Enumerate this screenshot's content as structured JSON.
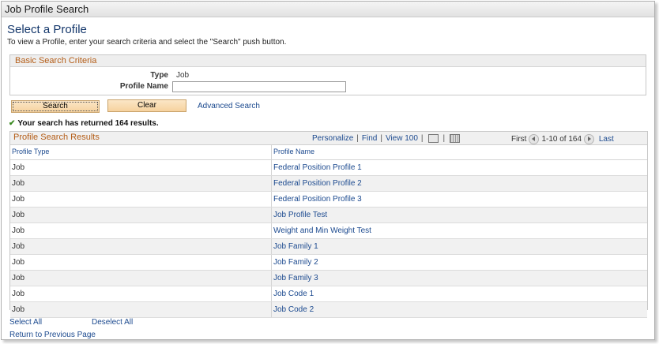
{
  "window": {
    "title": "Job Profile Search"
  },
  "page": {
    "heading": "Select a Profile",
    "instructions": "To view a Profile, enter your search criteria and select the \"Search\" push button."
  },
  "criteria": {
    "header": "Basic Search Criteria",
    "type_label": "Type",
    "type_value": "Job",
    "name_label": "Profile Name",
    "name_value": ""
  },
  "actions": {
    "search": "Search",
    "clear": "Clear",
    "advanced": "Advanced Search"
  },
  "status": "Your search has returned 164 results.",
  "grid": {
    "title": "Profile Search Results",
    "personalize": "Personalize",
    "find": "Find",
    "view100": "View 100",
    "first": "First",
    "range": "1-10 of 164",
    "last": "Last",
    "columns": [
      "Profile Type",
      "Profile Name"
    ],
    "rows": [
      {
        "type": "Job",
        "name": "Federal Position Profile 1"
      },
      {
        "type": "Job",
        "name": "Federal Position Profile 2"
      },
      {
        "type": "Job",
        "name": "Federal Position Profile 3"
      },
      {
        "type": "Job",
        "name": "Job Profile Test"
      },
      {
        "type": "Job",
        "name": "Weight and Min Weight Test"
      },
      {
        "type": "Job",
        "name": "Job Family 1"
      },
      {
        "type": "Job",
        "name": "Job Family 2"
      },
      {
        "type": "Job",
        "name": "Job Family 3"
      },
      {
        "type": "Job",
        "name": "Job Code 1"
      },
      {
        "type": "Job",
        "name": "Job Code 2"
      }
    ]
  },
  "footer": {
    "select_all": "Select All",
    "deselect_all": "Deselect All",
    "return": "Return to Previous Page"
  }
}
